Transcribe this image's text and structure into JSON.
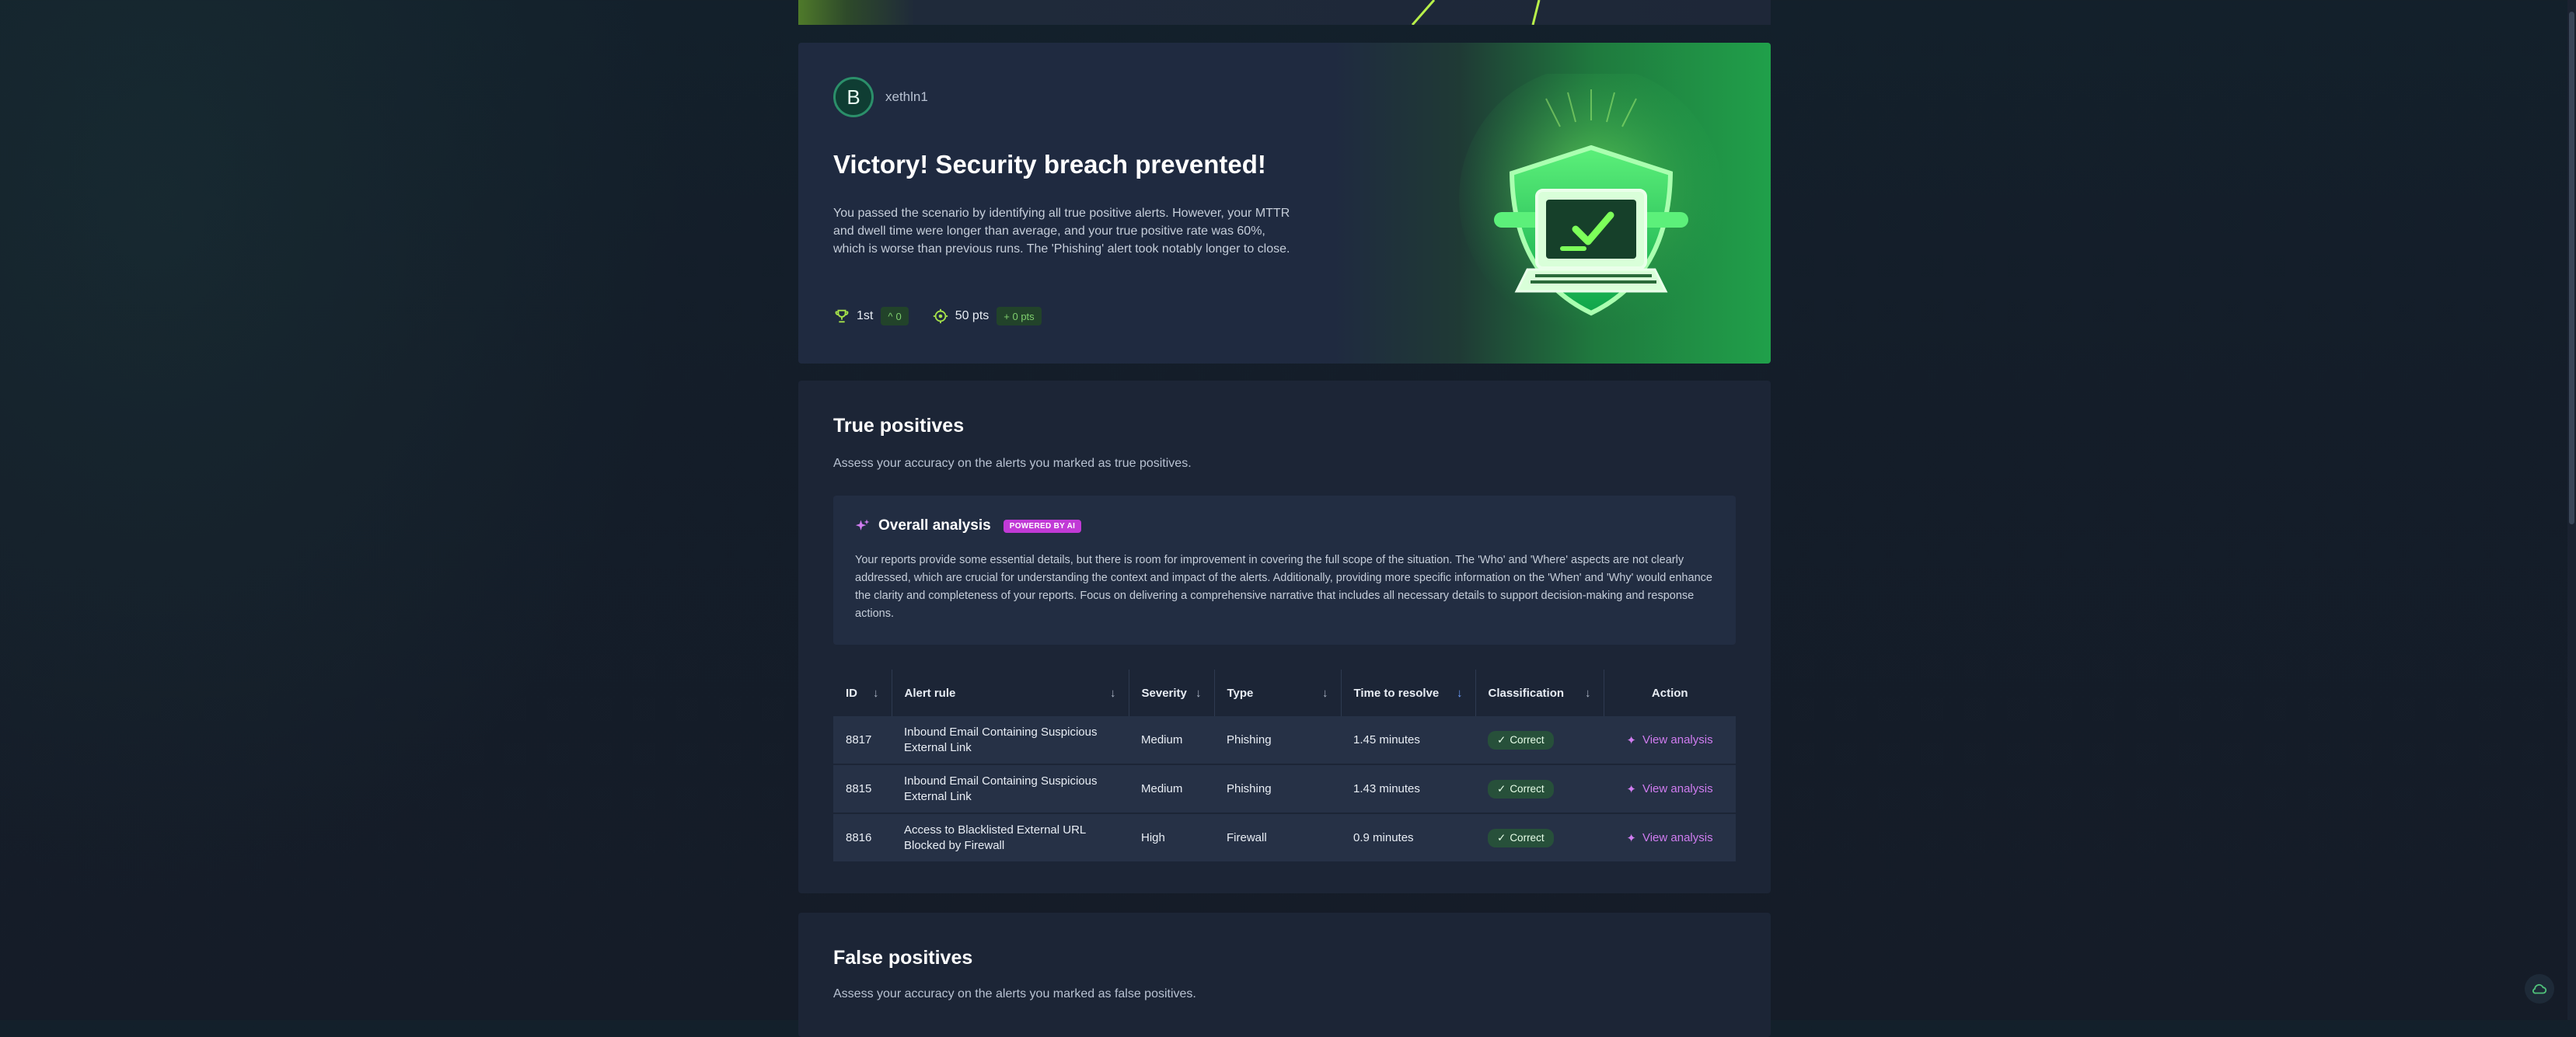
{
  "hero": {
    "avatar_letter": "B",
    "username": "xethln1",
    "title": "Victory! Security breach prevented!",
    "description": "You passed the scenario by identifying all true positive alerts. However, your MTTR and dwell time were longer than average, and your true positive rate was 60%, which is worse than previous runs. The 'Phishing' alert took notably longer to close.",
    "rank": "1st",
    "rank_change": "0",
    "points": "50 pts",
    "points_change": "+ 0 pts",
    "icons": [
      "trophy-icon",
      "target-icon",
      "shield-laptop-illustration"
    ]
  },
  "true_positives": {
    "title": "True positives",
    "subtitle": "Assess your accuracy on the alerts you marked as true positives.",
    "analysis": {
      "title": "Overall analysis",
      "badge": "POWERED BY AI",
      "text": "Your reports provide some essential details, but there is room for improvement in covering the full scope of the situation. The 'Who' and 'Where' aspects are not clearly addressed, which are crucial for understanding the context and impact of the alerts. Additionally, providing more specific information on the 'When' and 'Why' would enhance the clarity and completeness of your reports. Focus on delivering a comprehensive narrative that includes all necessary details to support decision-making and response actions."
    },
    "columns": {
      "id": "ID",
      "rule": "Alert rule",
      "severity": "Severity",
      "type": "Type",
      "time": "Time to resolve",
      "classification": "Classification",
      "action": "Action"
    },
    "rows": [
      {
        "id": "8817",
        "rule": "Inbound Email Containing Suspicious External Link",
        "severity": "Medium",
        "type": "Phishing",
        "time": "1.45 minutes",
        "classification": "Correct",
        "action": "View analysis"
      },
      {
        "id": "8815",
        "rule": "Inbound Email Containing Suspicious External Link",
        "severity": "Medium",
        "type": "Phishing",
        "time": "1.43 minutes",
        "classification": "Correct",
        "action": "View analysis"
      },
      {
        "id": "8816",
        "rule": "Access to Blacklisted External URL Blocked by Firewall",
        "severity": "High",
        "type": "Firewall",
        "time": "0.9 minutes",
        "classification": "Correct",
        "action": "View analysis"
      }
    ]
  },
  "false_positives": {
    "title": "False positives",
    "subtitle": "Assess your accuracy on the alerts you marked as false positives."
  },
  "colors": {
    "accent_green": "#7fcf6e",
    "ai_purple": "#c13ad6",
    "link_purple": "#d07cf0",
    "medium": "#7fa2ff",
    "high": "#ff9a3c"
  }
}
